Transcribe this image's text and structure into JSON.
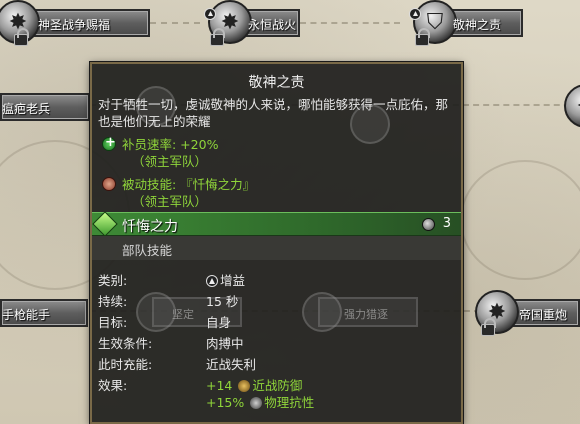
{
  "nodes": {
    "top_left": {
      "label": "神圣战争赐福",
      "icon": "star-burst-icon"
    },
    "top_mid": {
      "label": "永恒战火",
      "icon": "star-burst-icon"
    },
    "top_right": {
      "label": "敬神之责",
      "icon": "shield-icon"
    },
    "mid_left": {
      "label": "瘟疤老兵",
      "icon": "skull-icon"
    },
    "bottom_left": {
      "label": "手枪能手",
      "icon": "star-burst-icon"
    },
    "bottom_right": {
      "label": "帝国重炮",
      "icon": "star-burst-icon"
    },
    "ghost_a": {
      "label": "坚定"
    },
    "ghost_b": {
      "label": "强力猎逐"
    }
  },
  "tooltip": {
    "title": "敬神之责",
    "description": "对于牺牲一切，虔诚敬神的人来说，哪怕能够获得一点庇佑，那也是他们无上的荣耀",
    "effect1": {
      "text": "补员速率: +20%",
      "note": "（领主军队）",
      "icon": "plus-icon"
    },
    "effect2": {
      "text": "被动技能: 『忏悔之力』",
      "note": "（领主军队）",
      "icon": "fist-icon"
    }
  },
  "skill": {
    "name": "忏悔之力",
    "cooldown": "3",
    "type": "部队技能",
    "stats": [
      {
        "key": "类别:",
        "value": "增益"
      },
      {
        "key": "持续:",
        "value": "15 秒"
      },
      {
        "key": "目标:",
        "value": "自身"
      },
      {
        "key": "生效条件:",
        "value": "肉搏中"
      },
      {
        "key": "此时充能:",
        "value": "近战失利"
      },
      {
        "key": "效果:",
        "value": "+14",
        "value_label": "近战防御"
      }
    ],
    "effect_line2": {
      "value": "+15%",
      "label": "物理抗性"
    }
  },
  "colors": {
    "accent_green": "#8fd53a",
    "skill_bar": "#3e8a36",
    "tooltip_border": "#7a6a48"
  }
}
